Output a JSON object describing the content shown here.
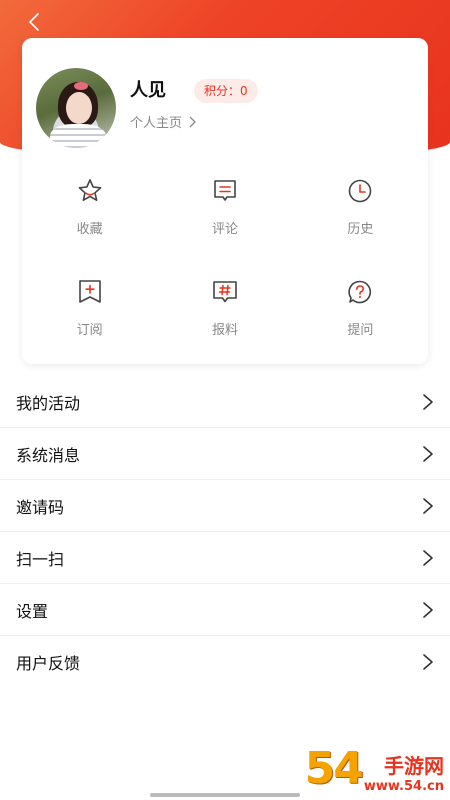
{
  "profile": {
    "username": "人见",
    "points_label": "积分：0",
    "homepage_link": "个人主页"
  },
  "quick_actions": [
    {
      "label": "收藏",
      "icon": "star-icon"
    },
    {
      "label": "评论",
      "icon": "comment-icon"
    },
    {
      "label": "历史",
      "icon": "clock-icon"
    },
    {
      "label": "订阅",
      "icon": "bookmark-plus-icon"
    },
    {
      "label": "报料",
      "icon": "hashtag-message-icon"
    },
    {
      "label": "提问",
      "icon": "question-icon"
    }
  ],
  "menu": [
    {
      "label": "我的活动"
    },
    {
      "label": "系统消息"
    },
    {
      "label": "邀请码"
    },
    {
      "label": "扫一扫"
    },
    {
      "label": "设置"
    },
    {
      "label": "用户反馈"
    }
  ],
  "watermark": {
    "number": "54",
    "name": "手游网",
    "url": "www.54.cn"
  },
  "colors": {
    "brand": "#e8331e",
    "header_gradient_start": "#f26a3c",
    "icon_stroke": "#444444",
    "icon_accent": "#e8331e",
    "muted_text": "#888888"
  }
}
